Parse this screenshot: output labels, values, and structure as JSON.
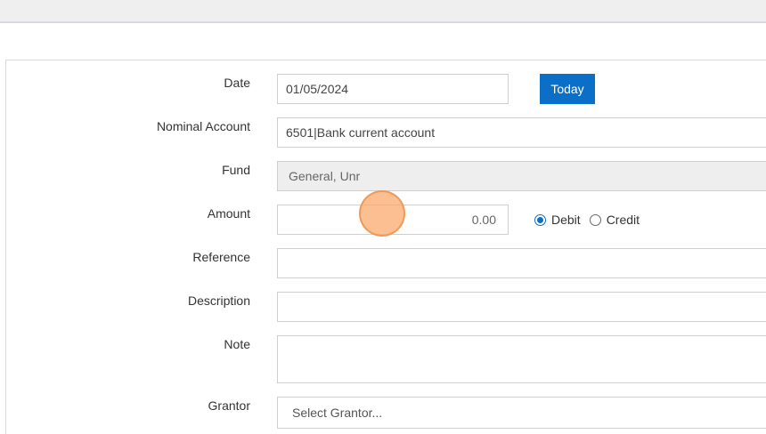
{
  "form": {
    "date": {
      "label": "Date",
      "value": "01/05/2024",
      "today_label": "Today"
    },
    "nominal_account": {
      "label": "Nominal Account",
      "value": "6501|Bank current account"
    },
    "fund": {
      "label": "Fund",
      "value": "General, Unr"
    },
    "amount": {
      "label": "Amount",
      "value": "0.00",
      "debit_label": "Debit",
      "credit_label": "Credit",
      "selected": "Debit"
    },
    "reference": {
      "label": "Reference",
      "value": ""
    },
    "description": {
      "label": "Description",
      "value": ""
    },
    "note": {
      "label": "Note",
      "value": ""
    },
    "grantor": {
      "label": "Grantor",
      "placeholder": "Select Grantor..."
    }
  },
  "colors": {
    "accent": "#0b6fc8",
    "cursor_highlight": "#f7b27a"
  }
}
